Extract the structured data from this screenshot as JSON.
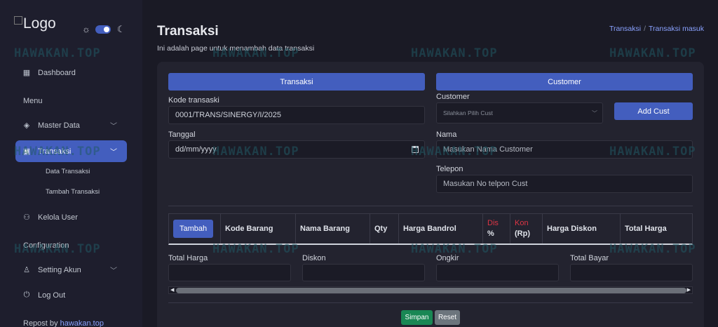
{
  "sidebar": {
    "logo_text": "Logo",
    "menu_heading": "Menu",
    "config_heading": "Configuration",
    "items": [
      {
        "label": "Dashboard",
        "icon": "grid-icon"
      },
      {
        "label": "Master Data",
        "icon": "stack-icon"
      },
      {
        "label": "Transaksi",
        "icon": "cash-icon"
      },
      {
        "label": "Kelola User",
        "icon": "people-icon"
      },
      {
        "label": "Setting Akun",
        "icon": "person-gear-icon"
      },
      {
        "label": "Log Out",
        "icon": "power-icon"
      }
    ],
    "sub_items": [
      "Data Transaksi",
      "Tambah Transaksi"
    ],
    "repost_prefix": "Repost by",
    "repost_link": "hawakan.top"
  },
  "header": {
    "title": "Transaksi",
    "subtitle": "Ini adalah page untuk menambah data transaksi",
    "breadcrumb": [
      "Transaksi",
      "Transaksi masuk"
    ]
  },
  "form": {
    "transaksi_header": "Transaksi",
    "customer_header": "Customer",
    "kode_label": "Kode transaski",
    "kode_value": "0001/TRANS/SINERGY/I/2025",
    "tanggal_label": "Tanggal",
    "tanggal_placeholder": "dd/mm/yyyy",
    "customer_label": "Customer",
    "customer_placeholder": "Silahkan Pilih Cust",
    "add_cust_button": "Add Cust",
    "nama_label": "Nama",
    "nama_placeholder": "Masukan Nama Customer",
    "telepon_label": "Telepon",
    "telepon_placeholder": "Masukan No telpon Cust"
  },
  "table": {
    "tambah_button": "Tambah",
    "columns": [
      "Kode Barang",
      "Nama Barang",
      "Qty",
      "Harga Bandrol"
    ],
    "dis_top": "Dis",
    "dis_bottom": "%",
    "kon_top": "Kon",
    "kon_bottom": "(Rp)",
    "columns_after": [
      "Harga Diskon",
      "Total Harga"
    ]
  },
  "totals": {
    "total_harga_label": "Total Harga",
    "diskon_label": "Diskon",
    "ongkir_label": "Ongkir",
    "total_bayar_label": "Total Bayar"
  },
  "actions": {
    "simpan": "Simpan",
    "reset": "Reset"
  },
  "watermark": "HAWAKAN.TOP",
  "colors": {
    "accent": "#435ebe",
    "success": "#198754",
    "secondary": "#6c757d",
    "danger": "#dc3545"
  }
}
